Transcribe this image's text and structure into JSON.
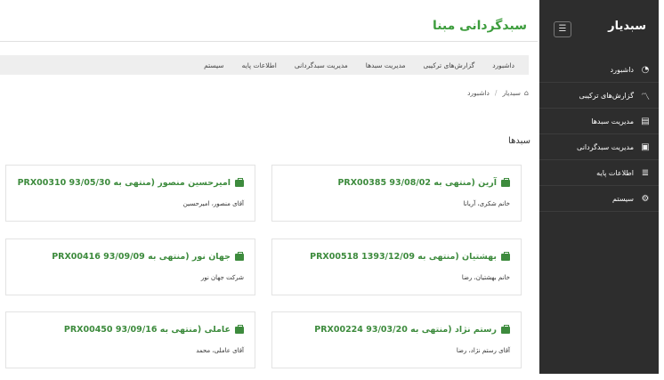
{
  "sidebar": {
    "brand": "سبدیار",
    "toggle_icon": "hamburger-icon",
    "items": [
      {
        "label": "داشبورد",
        "icon": "dashboard-icon"
      },
      {
        "label": "گزارش‌های ترکیبی",
        "icon": "chart-line-icon"
      },
      {
        "label": "مدیریت سبدها",
        "icon": "document-icon"
      },
      {
        "label": "مدیریت سبدگردانی",
        "icon": "briefcase-icon"
      },
      {
        "label": "اطلاعات پایه",
        "icon": "database-icon"
      },
      {
        "label": "سیستم",
        "icon": "gear-icon"
      }
    ]
  },
  "header": {
    "title": "سبدگردانی مبنا"
  },
  "navbar": {
    "items": [
      "داشبورد",
      "گزارش‌های ترکیبی",
      "مدیریت سبدها",
      "مدیریت سبدگردانی",
      "اطلاعات پایه",
      "سیستم"
    ]
  },
  "breadcrumb": {
    "home": "سبدیار",
    "current": "داشبورد"
  },
  "section": {
    "title": "سبدها"
  },
  "cards": [
    {
      "title": "آرین (منتهی به 93/08/02 PRX00385",
      "subtitle": "خانم شکری، آریانا"
    },
    {
      "title": "امیرحسین منصور (منتهی به 93/05/30 PRX00310",
      "subtitle": "آقای منصور، امیرحسین"
    },
    {
      "title": "بهشتیان (منتهی به 1393/12/09 PRX00518",
      "subtitle": "خانم بهشتیان، رضا"
    },
    {
      "title": "جهان نور (منتهی به 93/09/09 PRX00416",
      "subtitle": "شرکت جهان نور"
    },
    {
      "title": "رستم نژاد (منتهی به 93/03/20 PRX00224",
      "subtitle": "آقای رستم نژاد، رضا"
    },
    {
      "title": "عاملی (منتهی به 93/09/16 PRX00450",
      "subtitle": "آقای عاملی، محمد"
    }
  ],
  "colors": {
    "accent": "#3d8b3d",
    "sidebar_bg": "#2d2d2d",
    "navbar_bg": "#eeeeee"
  }
}
